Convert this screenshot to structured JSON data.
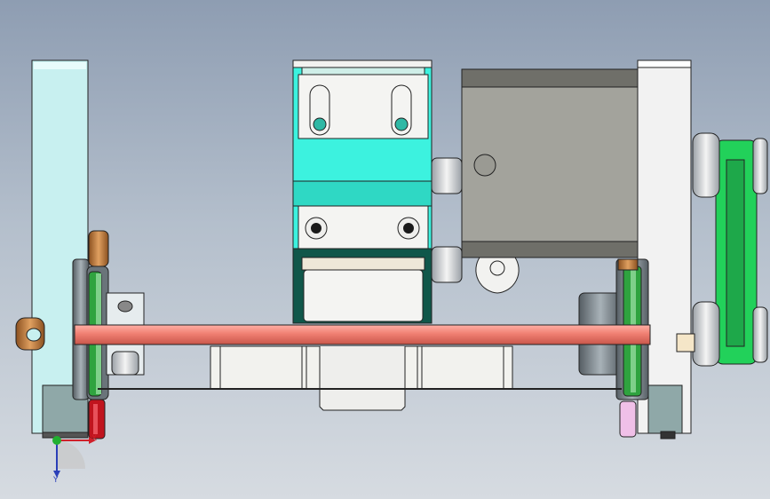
{
  "view": {
    "background_top": "#8e9db2",
    "background_bottom": "#d6dbe1"
  },
  "triad": {
    "x_label": "X",
    "y_label": "Y",
    "x_color": "#d0202a",
    "y_color": "#2a3fb8",
    "z_color": "#20b030"
  },
  "parts": [
    {
      "name": "left-side-plate",
      "color": "#c8f0f0"
    },
    {
      "name": "slider-block",
      "color": "#3cf2df"
    },
    {
      "name": "motor-housing",
      "color": "#a3a39c"
    },
    {
      "name": "right-side-plate",
      "color": "#f2f2f2"
    },
    {
      "name": "drive-shaft",
      "color": "#f07f72"
    },
    {
      "name": "timing-belt",
      "color": "#22d15a"
    },
    {
      "name": "pulley-disc",
      "color": "#2fa33f"
    },
    {
      "name": "bronze-bushing",
      "color": "#c08040"
    },
    {
      "name": "red-roller",
      "color": "#c0141e"
    },
    {
      "name": "pink-roller",
      "color": "#f0c0e8"
    }
  ]
}
